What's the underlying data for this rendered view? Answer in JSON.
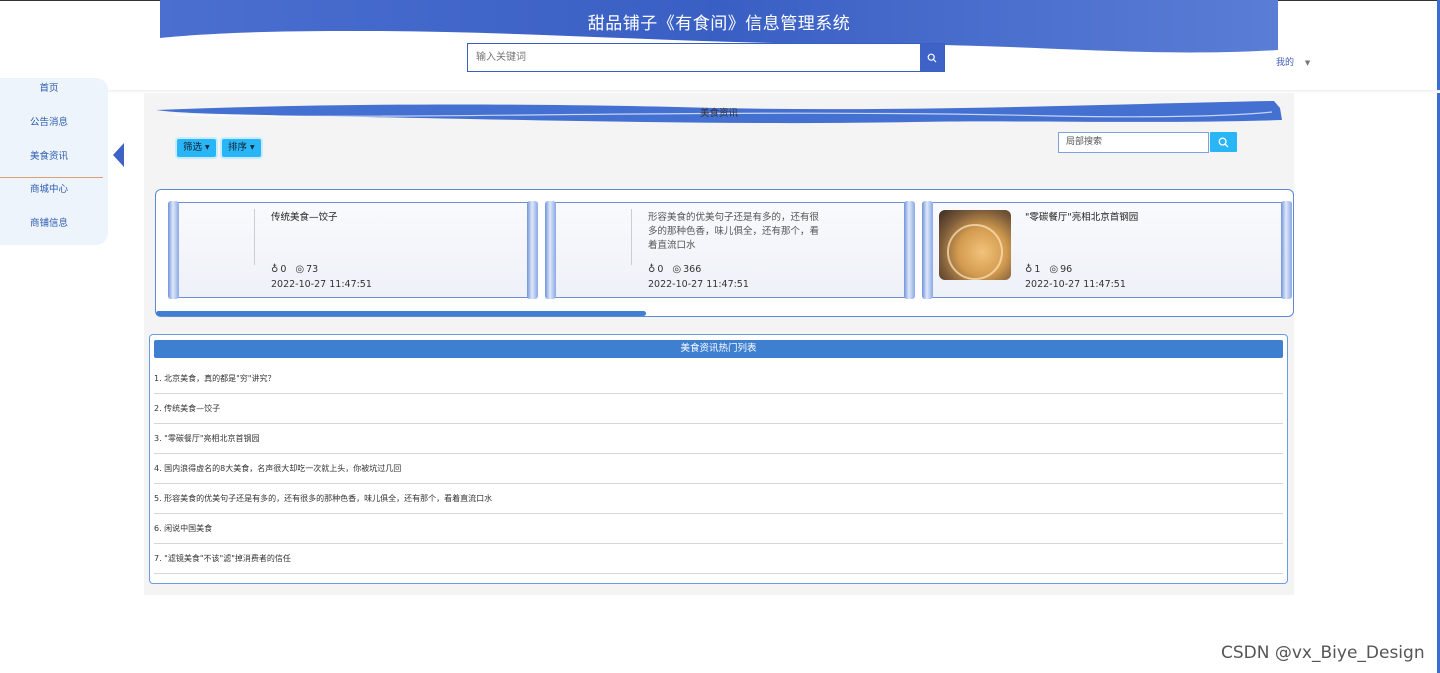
{
  "header": {
    "title": "甜品铺子《有食间》信息管理系统",
    "search_placeholder": "输入关键词",
    "account_label": "我的",
    "theme_color": "#3f62c7"
  },
  "sidebar": {
    "items": [
      {
        "label": "首页"
      },
      {
        "label": "公告消息"
      },
      {
        "label": "美食资讯"
      },
      {
        "label": "商城中心"
      },
      {
        "label": "商铺信息"
      }
    ],
    "active": "美食资讯"
  },
  "main": {
    "section_title": "美食资讯",
    "filter_label": "筛选",
    "sort_label": "排序",
    "local_search_placeholder": "局部搜索",
    "cards": [
      {
        "title": "传统美食—饺子",
        "likes": "0",
        "views": "73",
        "date": "2022-10-27 11:47:51",
        "has_image": false
      },
      {
        "title": "形容美食的优美句子还是有多的，还有很多的那种色香，味儿俱全，还有那个，看着直流口水",
        "likes": "0",
        "views": "366",
        "date": "2022-10-27 11:47:51",
        "has_image": false
      },
      {
        "title": "\"零碳餐厅\"亮相北京首钢园",
        "likes": "1",
        "views": "96",
        "date": "2022-10-27 11:47:51",
        "has_image": true
      }
    ],
    "hot_list_title": "美食资讯热门列表",
    "hot_list": [
      "1. 北京美食，真的都是\"穷\"讲究？",
      "2. 传统美食—饺子",
      "3. \"零碳餐厅\"亮相北京首钢园",
      "4. 国内浪得虚名的8大美食，名声很大却吃一次就上头，你被坑过几回",
      "5. 形容美食的优美句子还是有多的，还有很多的那种色香，味儿俱全，还有那个，看着直流口水",
      "6. 闲说中国美食",
      "7. \"滤镜美食\"不该\"滤\"掉消费者的信任"
    ],
    "accent_color": "#29b6f6"
  },
  "watermark": "CSDN @vx_Biye_Design"
}
